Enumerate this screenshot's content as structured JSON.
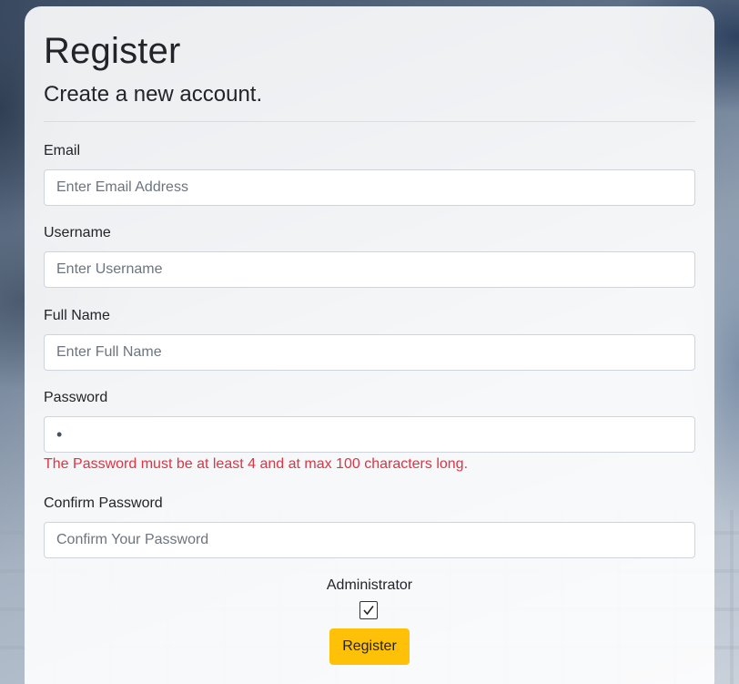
{
  "form": {
    "title": "Register",
    "subtitle": "Create a new account.",
    "email": {
      "label": "Email",
      "placeholder": "Enter Email Address"
    },
    "username": {
      "label": "Username",
      "placeholder": "Enter Username"
    },
    "full_name": {
      "label": "Full Name",
      "placeholder": "Enter Full Name"
    },
    "password": {
      "label": "Password",
      "value_masked": "•"
    },
    "password_error": "The Password must be at least 4 and at max 100 characters long.",
    "confirm_password": {
      "label": "Confirm Password",
      "placeholder": "Confirm Your Password"
    },
    "administrator": {
      "label": "Administrator",
      "checked": true
    },
    "submit_label": "Register"
  },
  "colors": {
    "accent_button": "#ffc107",
    "error_text": "#dc3545"
  }
}
